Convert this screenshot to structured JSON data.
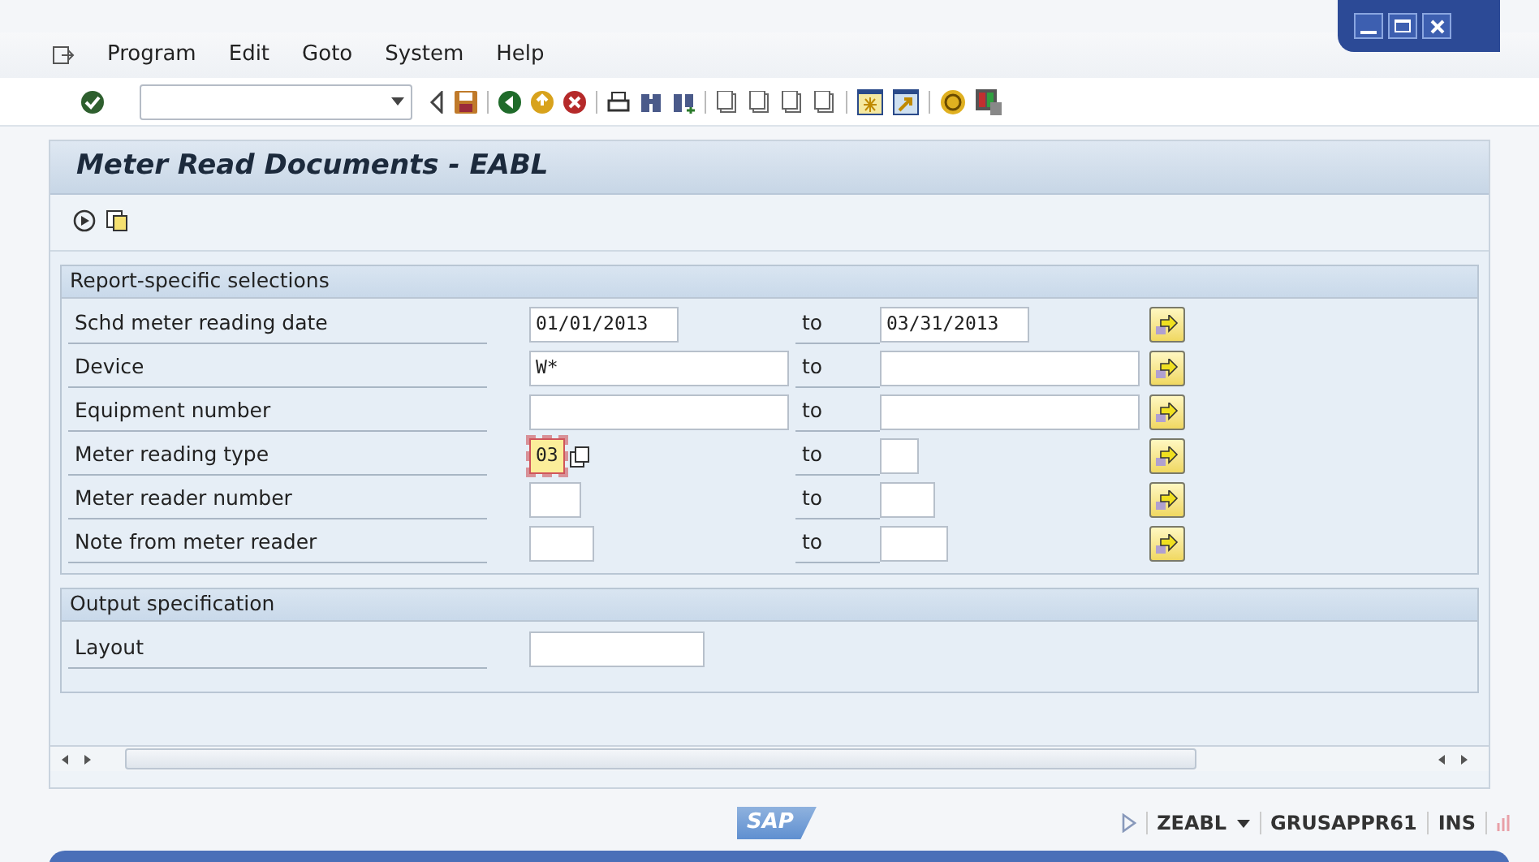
{
  "menu": [
    "Program",
    "Edit",
    "Goto",
    "System",
    "Help"
  ],
  "title": "Meter Read Documents - EABL",
  "sections": [
    {
      "title": "Report-specific selections",
      "rows": [
        {
          "label": "Schd meter reading date",
          "from": "01/01/2013",
          "to_label": "to",
          "to": "03/31/2013",
          "focused": false
        },
        {
          "label": "Device",
          "from": "W*",
          "to_label": "to",
          "focused": false
        },
        {
          "label": "Equipment number",
          "to_label": "to",
          "focused": false
        },
        {
          "label": "Meter reading type",
          "from": "03",
          "to_label": "to",
          "focused": true
        },
        {
          "label": "Meter reader number",
          "to_label": "to",
          "focused": false
        },
        {
          "label": "Note from meter reader",
          "to_label": "to",
          "focused": false
        }
      ]
    },
    {
      "title": "Output specification",
      "rows": [
        {
          "label": "Layout",
          "focused": false
        }
      ]
    }
  ],
  "logo": "SAP",
  "status_bar": {
    "transaction": "ZEABL",
    "server": "GRUSAPPR61",
    "mode": "INS"
  }
}
